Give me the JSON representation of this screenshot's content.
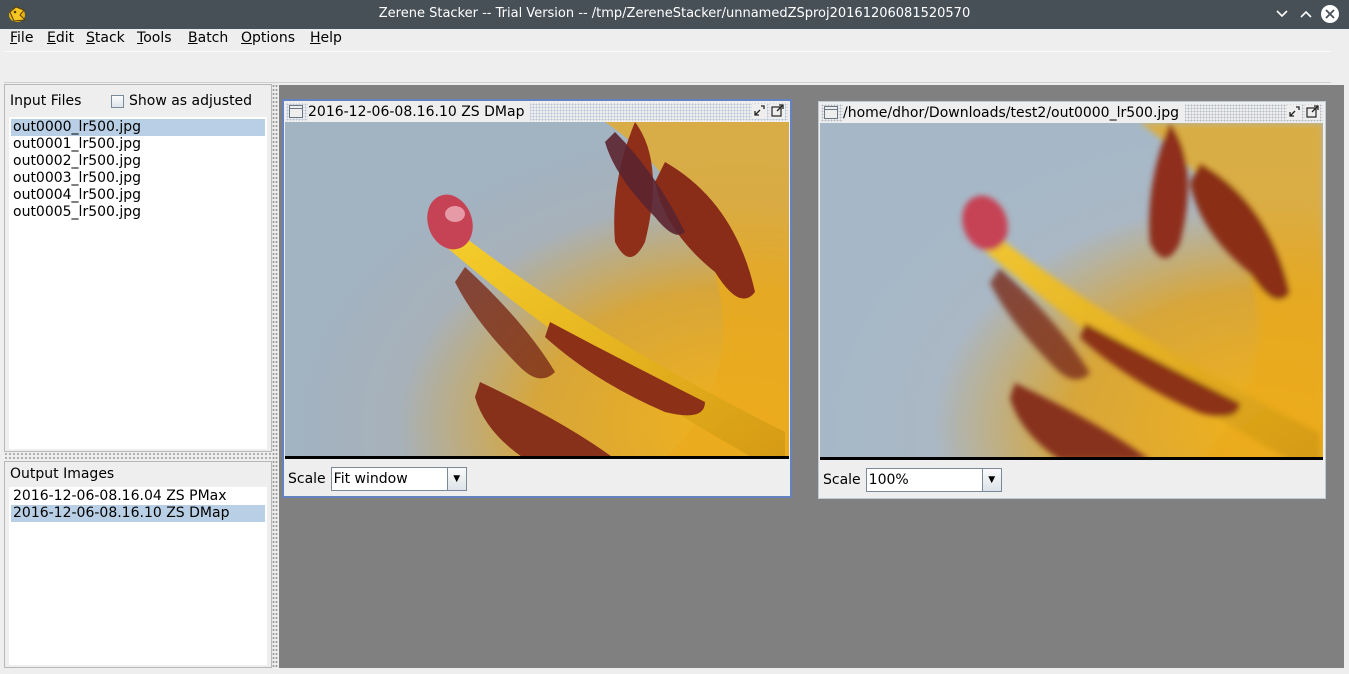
{
  "window": {
    "title": "Zerene Stacker -- Trial Version -- /tmp/ZereneStacker/unnamedZSproj20161206081520570",
    "controls": {
      "minimize": "chevron-down-icon",
      "maximize": "chevron-up-icon",
      "close": "close-icon"
    }
  },
  "menu": {
    "items": [
      {
        "mnemonic": "F",
        "rest": "ile"
      },
      {
        "mnemonic": "E",
        "rest": "dit"
      },
      {
        "mnemonic": "S",
        "rest": "tack"
      },
      {
        "mnemonic": "T",
        "rest": "ools"
      },
      {
        "mnemonic": "B",
        "rest": "atch"
      },
      {
        "mnemonic": "O",
        "rest": "ptions"
      },
      {
        "mnemonic": "H",
        "rest": "elp"
      }
    ]
  },
  "input_files": {
    "header": "Input Files",
    "show_adjusted_label": "Show as adjusted",
    "show_adjusted_checked": false,
    "files": [
      "out0000_lr500.jpg",
      "out0001_lr500.jpg",
      "out0002_lr500.jpg",
      "out0003_lr500.jpg",
      "out0004_lr500.jpg",
      "out0005_lr500.jpg"
    ],
    "selected_index": 0
  },
  "output_images": {
    "header": "Output Images",
    "items": [
      "2016-12-06-08.16.04 ZS PMax",
      "2016-12-06-08.16.10 ZS DMap"
    ],
    "selected_index": 1
  },
  "frames": [
    {
      "title": "2016-12-06-08.16.10 ZS DMap",
      "scale_label": "Scale",
      "scale_value": "Fit window",
      "active": true
    },
    {
      "title": "/home/dhor/Downloads/test2/out0000_lr500.jpg",
      "scale_label": "Scale",
      "scale_value": "100%",
      "active": false
    }
  ],
  "colors": {
    "titlebar_bg": "#475057",
    "selection_bg": "#b8cfe5",
    "desktop_bg": "#808080",
    "active_frame_border": "#6382bf"
  }
}
